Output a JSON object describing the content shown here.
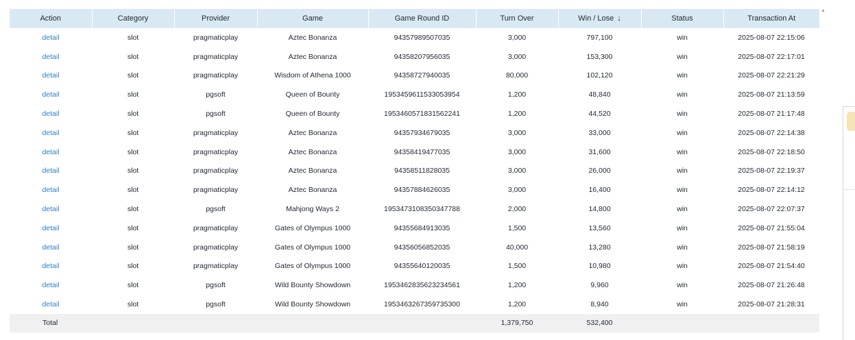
{
  "table": {
    "columns": [
      "Action",
      "Category",
      "Provider",
      "Game",
      "Game Round ID",
      "Turn Over",
      "Win / Lose",
      "Status",
      "Transaction At"
    ],
    "sort_indicator": "↓",
    "rows": [
      {
        "action": "detail",
        "category": "slot",
        "provider": "pragmaticplay",
        "game": "Aztec Bonanza",
        "round_id": "94357989507035",
        "turnover": "3,000",
        "win_lose": "797,100",
        "status": "win",
        "transaction_at": "2025-08-07 22:15:06"
      },
      {
        "action": "detail",
        "category": "slot",
        "provider": "pragmaticplay",
        "game": "Aztec Bonanza",
        "round_id": "94358207956035",
        "turnover": "3,000",
        "win_lose": "153,300",
        "status": "win",
        "transaction_at": "2025-08-07 22:17:01"
      },
      {
        "action": "detail",
        "category": "slot",
        "provider": "pragmaticplay",
        "game": "Wisdom of Athena 1000",
        "round_id": "94358727940035",
        "turnover": "80,000",
        "win_lose": "102,120",
        "status": "win",
        "transaction_at": "2025-08-07 22:21:29"
      },
      {
        "action": "detail",
        "category": "slot",
        "provider": "pgsoft",
        "game": "Queen of Bounty",
        "round_id": "1953459611533053954",
        "turnover": "1,200",
        "win_lose": "48,840",
        "status": "win",
        "transaction_at": "2025-08-07 21:13:59"
      },
      {
        "action": "detail",
        "category": "slot",
        "provider": "pgsoft",
        "game": "Queen of Bounty",
        "round_id": "1953460571831562241",
        "turnover": "1,200",
        "win_lose": "44,520",
        "status": "win",
        "transaction_at": "2025-08-07 21:17:48"
      },
      {
        "action": "detail",
        "category": "slot",
        "provider": "pragmaticplay",
        "game": "Aztec Bonanza",
        "round_id": "94357934679035",
        "turnover": "3,000",
        "win_lose": "33,000",
        "status": "win",
        "transaction_at": "2025-08-07 22:14:38"
      },
      {
        "action": "detail",
        "category": "slot",
        "provider": "pragmaticplay",
        "game": "Aztec Bonanza",
        "round_id": "94358419477035",
        "turnover": "3,000",
        "win_lose": "31,600",
        "status": "win",
        "transaction_at": "2025-08-07 22:18:50"
      },
      {
        "action": "detail",
        "category": "slot",
        "provider": "pragmaticplay",
        "game": "Aztec Bonanza",
        "round_id": "94358511828035",
        "turnover": "3,000",
        "win_lose": "26,000",
        "status": "win",
        "transaction_at": "2025-08-07 22:19:37"
      },
      {
        "action": "detail",
        "category": "slot",
        "provider": "pragmaticplay",
        "game": "Aztec Bonanza",
        "round_id": "94357884626035",
        "turnover": "3,000",
        "win_lose": "16,400",
        "status": "win",
        "transaction_at": "2025-08-07 22:14:12"
      },
      {
        "action": "detail",
        "category": "slot",
        "provider": "pgsoft",
        "game": "Mahjong Ways 2",
        "round_id": "1953473108350347788",
        "turnover": "2,000",
        "win_lose": "14,800",
        "status": "win",
        "transaction_at": "2025-08-07 22:07:37"
      },
      {
        "action": "detail",
        "category": "slot",
        "provider": "pragmaticplay",
        "game": "Gates of Olympus 1000",
        "round_id": "94355684913035",
        "turnover": "1,500",
        "win_lose": "13,560",
        "status": "win",
        "transaction_at": "2025-08-07 21:55:04"
      },
      {
        "action": "detail",
        "category": "slot",
        "provider": "pragmaticplay",
        "game": "Gates of Olympus 1000",
        "round_id": "94356056852035",
        "turnover": "40,000",
        "win_lose": "13,280",
        "status": "win",
        "transaction_at": "2025-08-07 21:58:19"
      },
      {
        "action": "detail",
        "category": "slot",
        "provider": "pragmaticplay",
        "game": "Gates of Olympus 1000",
        "round_id": "94355640120035",
        "turnover": "1,500",
        "win_lose": "10,980",
        "status": "win",
        "transaction_at": "2025-08-07 21:54:40"
      },
      {
        "action": "detail",
        "category": "slot",
        "provider": "pgsoft",
        "game": "Wild Bounty Showdown",
        "round_id": "1953462835623234561",
        "turnover": "1,200",
        "win_lose": "9,960",
        "status": "win",
        "transaction_at": "2025-08-07 21:26:48"
      },
      {
        "action": "detail",
        "category": "slot",
        "provider": "pgsoft",
        "game": "Wild Bounty Showdown",
        "round_id": "1953463267359735300",
        "turnover": "1,200",
        "win_lose": "8,940",
        "status": "win",
        "transaction_at": "2025-08-07 21:28:31"
      }
    ],
    "total": {
      "label": "Total",
      "turnover": "1,379,750",
      "win_lose": "532,400"
    }
  },
  "scrollbar": {
    "up_arrow": "▲"
  },
  "colors": {
    "header_bg": "#d8e9f3",
    "link": "#2a7fc7",
    "total_bg": "#f0f0f0"
  }
}
